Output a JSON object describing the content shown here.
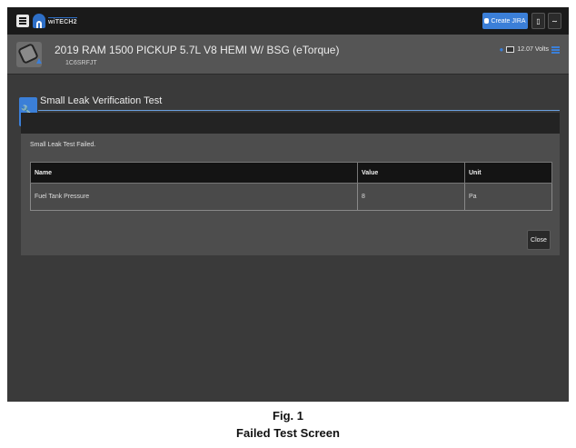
{
  "app": {
    "logo_text": "wiTECH2"
  },
  "topbar": {
    "create_jira_label": "Create JIRA",
    "colors": {
      "accent": "#3b7fd8",
      "bar": "#1a1a1a"
    }
  },
  "vehicle": {
    "title": "2019 RAM 1500 PICKUP 5.7L V8 HEMI W/ BSG (eTorque)",
    "vin": "1C6SRFJT",
    "volts": "12.07 Volts"
  },
  "section": {
    "title": "Small Leak Verification Test"
  },
  "panel": {
    "message": "Small Leak Test Failed.",
    "table": {
      "headers": [
        "Name",
        "Value",
        "Unit"
      ],
      "rows": [
        [
          "Fuel Tank Pressure",
          "8",
          "Pa"
        ]
      ]
    },
    "close_label": "Close"
  },
  "caption": {
    "fig": "Fig. 1",
    "title": "Failed Test Screen"
  }
}
